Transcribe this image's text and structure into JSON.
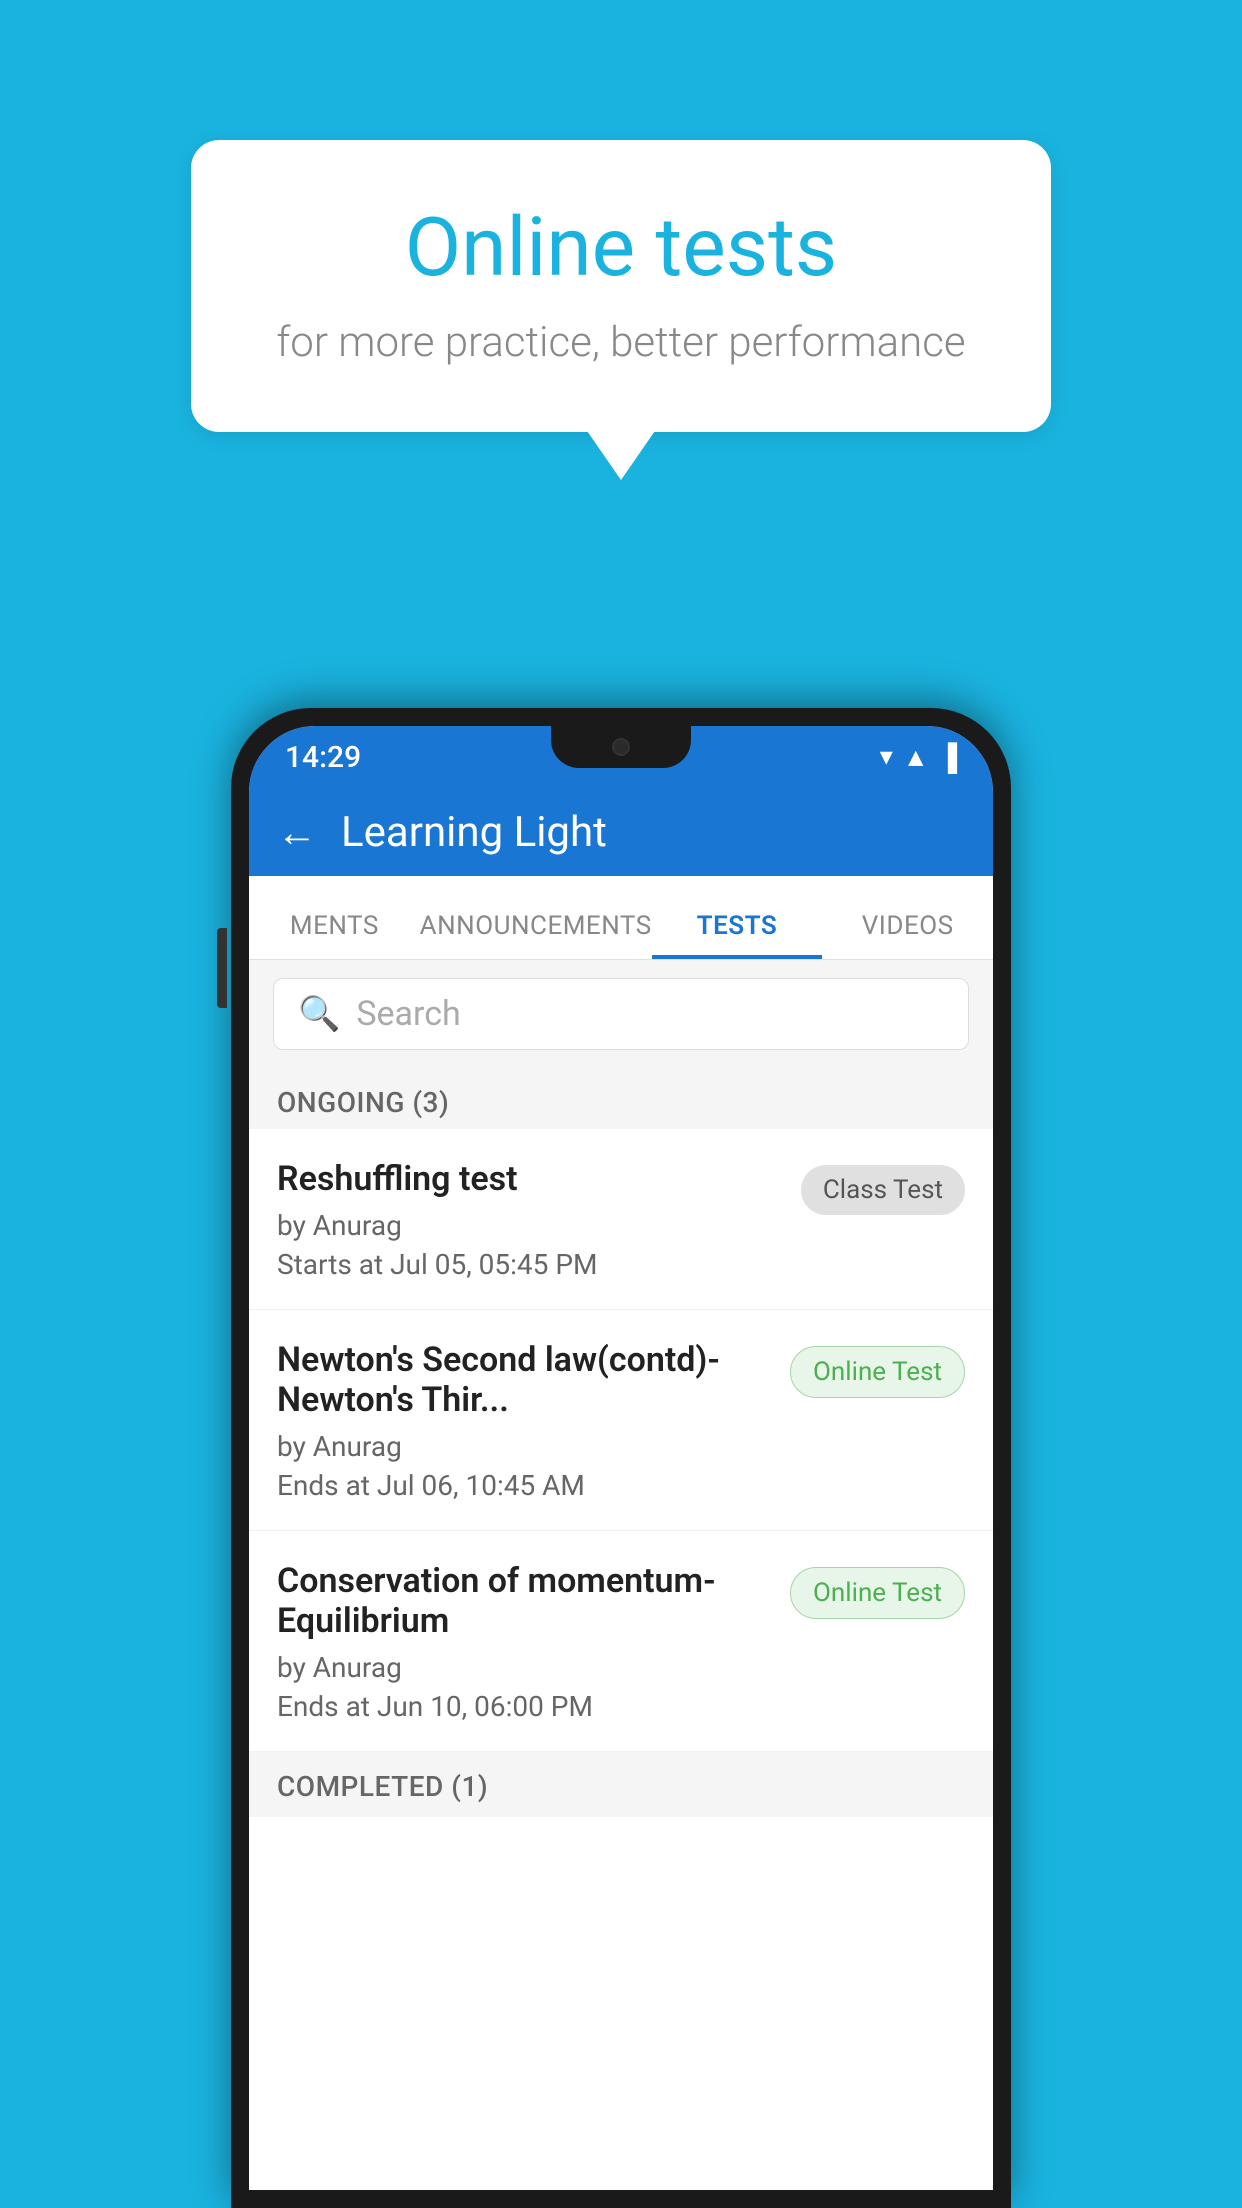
{
  "background_color": "#1ab3e0",
  "bubble": {
    "title": "Online tests",
    "subtitle": "for more practice, better performance"
  },
  "phone": {
    "status_bar": {
      "time": "14:29",
      "icons": [
        "wifi",
        "signal",
        "battery"
      ]
    },
    "app_header": {
      "back_label": "←",
      "title": "Learning Light"
    },
    "tabs": [
      {
        "label": "MENTS",
        "active": false
      },
      {
        "label": "ANNOUNCEMENTS",
        "active": false
      },
      {
        "label": "TESTS",
        "active": true
      },
      {
        "label": "VIDEOS",
        "active": false
      }
    ],
    "search": {
      "placeholder": "Search"
    },
    "ongoing_section": {
      "label": "ONGOING (3)"
    },
    "tests": [
      {
        "name": "Reshuffling test",
        "author": "by Anurag",
        "time": "Starts at  Jul 05, 05:45 PM",
        "badge": "Class Test",
        "badge_type": "class"
      },
      {
        "name": "Newton's Second law(contd)-Newton's Thir...",
        "author": "by Anurag",
        "time": "Ends at  Jul 06, 10:45 AM",
        "badge": "Online Test",
        "badge_type": "online"
      },
      {
        "name": "Conservation of momentum-Equilibrium",
        "author": "by Anurag",
        "time": "Ends at  Jun 10, 06:00 PM",
        "badge": "Online Test",
        "badge_type": "online"
      }
    ],
    "completed_section": {
      "label": "COMPLETED (1)"
    }
  }
}
